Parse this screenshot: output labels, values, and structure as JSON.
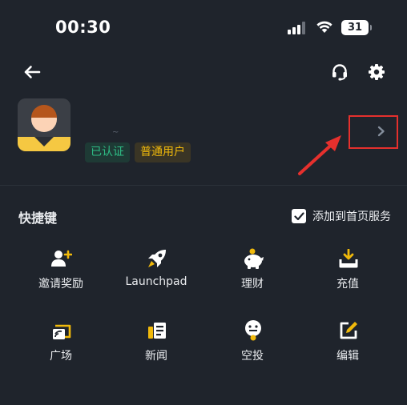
{
  "status_bar": {
    "time": "00:30",
    "battery": "31"
  },
  "colors": {
    "background": "#1f242c",
    "accent_yellow": "#f0b90b",
    "verified_green": "#2ebd85",
    "annotation_red": "#e5302d"
  },
  "header": {
    "back_icon": "arrow-left-icon",
    "support_icon": "headset-icon",
    "settings_icon": "gear-icon"
  },
  "profile": {
    "username": "~",
    "badges": [
      "已认证",
      "普通用户"
    ],
    "chevron": "›"
  },
  "shortcuts_section": {
    "title": "快捷键",
    "add_to_home_label": "添加到首页服务",
    "add_to_home_checked": true,
    "items": [
      {
        "label": "邀请奖励",
        "icon": "invite-user-icon"
      },
      {
        "label": "Launchpad",
        "icon": "rocket-icon"
      },
      {
        "label": "理财",
        "icon": "piggy-bank-icon"
      },
      {
        "label": "充值",
        "icon": "deposit-icon"
      },
      {
        "label": "广场",
        "icon": "square-feed-icon"
      },
      {
        "label": "新闻",
        "icon": "news-icon"
      },
      {
        "label": "空投",
        "icon": "airdrop-icon"
      },
      {
        "label": "编辑",
        "icon": "edit-icon"
      }
    ]
  }
}
